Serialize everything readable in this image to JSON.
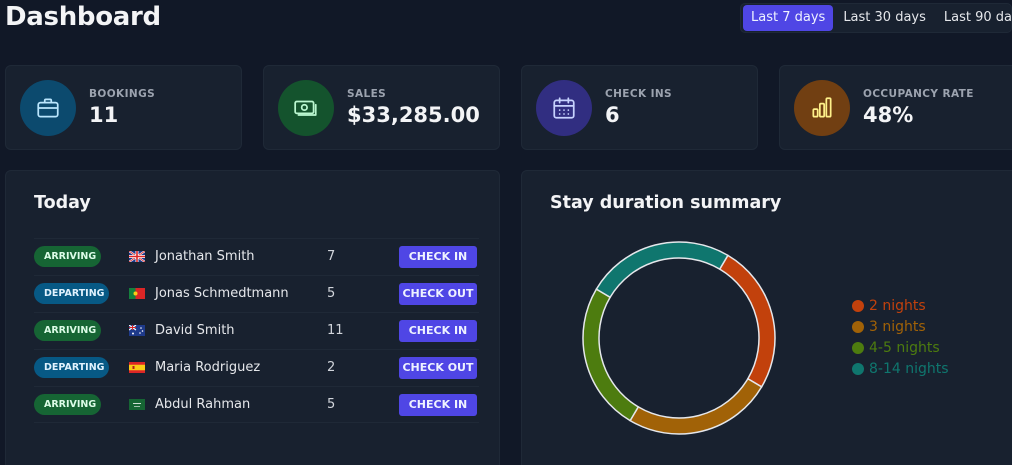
{
  "header": {
    "title": "Dashboard",
    "filters": [
      {
        "label": "Last 7 days",
        "active": true
      },
      {
        "label": "Last 30 days",
        "active": false
      },
      {
        "label": "Last 90 days",
        "active": false
      }
    ]
  },
  "stats": [
    {
      "label": "BOOKINGS",
      "value": "11",
      "icon": "briefcase-icon",
      "color": "#0c4a6e"
    },
    {
      "label": "SALES",
      "value": "$33,285.00",
      "icon": "banknotes-icon",
      "color": "#14532d"
    },
    {
      "label": "CHECK INS",
      "value": "6",
      "icon": "calendar-icon",
      "color": "#312e81"
    },
    {
      "label": "OCCUPANCY RATE",
      "value": "48%",
      "icon": "chart-bar-icon",
      "color": "#713f12"
    }
  ],
  "today": {
    "title": "Today",
    "rows": [
      {
        "status": "ARRIVING",
        "flag": "gb",
        "guest": "Jonathan Smith",
        "nights": "7",
        "action": "CHECK IN"
      },
      {
        "status": "DEPARTING",
        "flag": "pt",
        "guest": "Jonas Schmedtmann",
        "nights": "5",
        "action": "CHECK OUT"
      },
      {
        "status": "ARRIVING",
        "flag": "au",
        "guest": "David Smith",
        "nights": "11",
        "action": "CHECK IN"
      },
      {
        "status": "DEPARTING",
        "flag": "es",
        "guest": "Maria Rodriguez",
        "nights": "2",
        "action": "CHECK OUT"
      },
      {
        "status": "ARRIVING",
        "flag": "sa",
        "guest": "Abdul Rahman",
        "nights": "5",
        "action": "CHECK IN"
      }
    ]
  },
  "duration": {
    "title": "Stay duration summary",
    "chart_data": {
      "type": "pie",
      "donut": true,
      "categories": [
        "2 nights",
        "3 nights",
        "4-5 nights",
        "8-14 nights"
      ],
      "values": [
        1,
        1,
        1,
        1
      ],
      "colors": [
        "#c2410c",
        "#a16207",
        "#4d7c0f",
        "#0f766e"
      ],
      "legend": "right"
    }
  }
}
